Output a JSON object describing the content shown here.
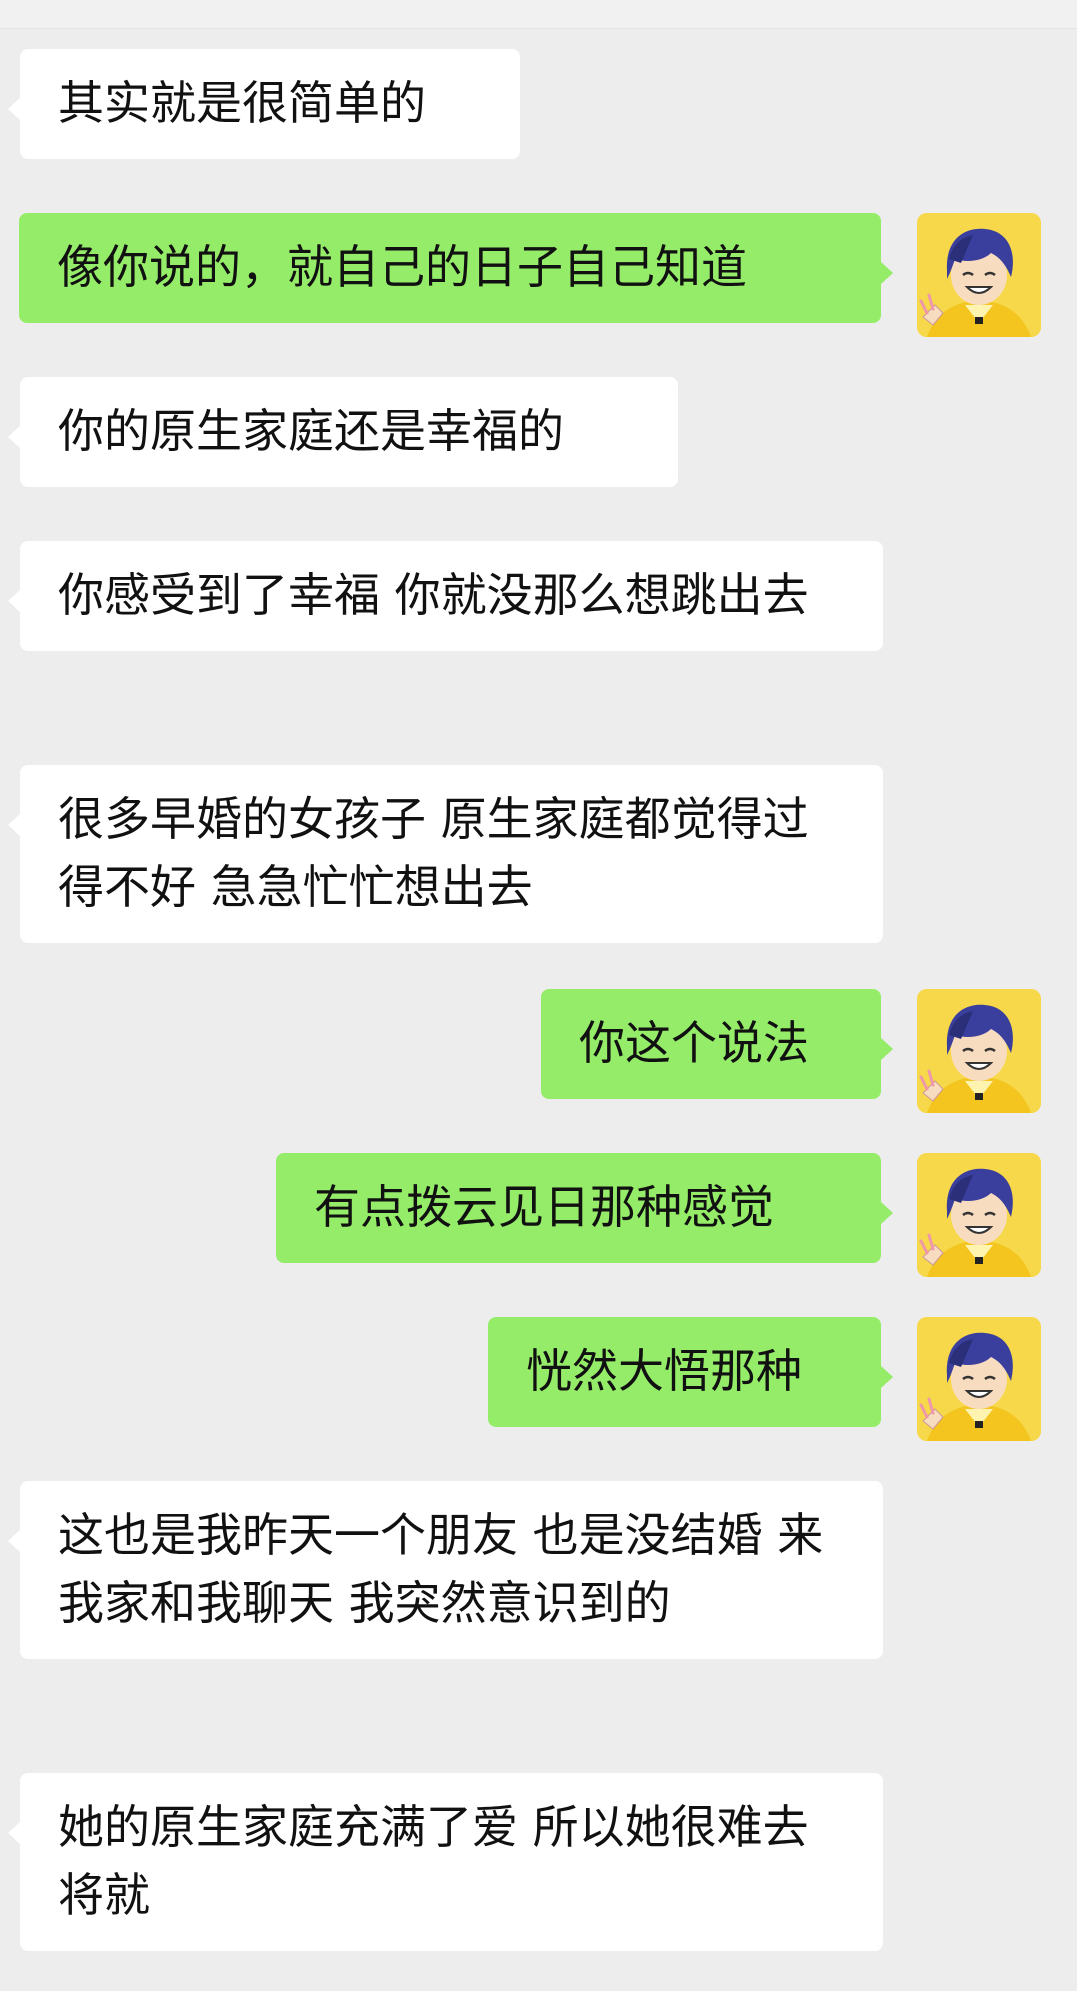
{
  "conversation": {
    "messages": [
      {
        "side": "in",
        "text": "其实就是很简单的"
      },
      {
        "side": "out",
        "text": "像你说的，就自己的日子自己知道"
      },
      {
        "side": "in",
        "text": "你的原生家庭还是幸福的"
      },
      {
        "side": "in",
        "text": "你感受到了幸福 你就没那么想跳出去"
      },
      {
        "side": "in",
        "text": "很多早婚的女孩子 原生家庭都觉得过得不好 急急忙忙想出去"
      },
      {
        "side": "out",
        "text": "你这个说法"
      },
      {
        "side": "out",
        "text": "有点拨云见日那种感觉"
      },
      {
        "side": "out",
        "text": "恍然大悟那种"
      },
      {
        "side": "in",
        "text": "这也是我昨天一个朋友 也是没结婚 来我家和我聊天 我突然意识到的"
      },
      {
        "side": "in",
        "text": "她的原生家庭充满了爱 所以她很难去将就"
      }
    ]
  },
  "colors": {
    "background": "#ededed",
    "incoming_bubble": "#ffffff",
    "outgoing_bubble": "#95ec69",
    "avatar_bg": "#f7d84a"
  }
}
